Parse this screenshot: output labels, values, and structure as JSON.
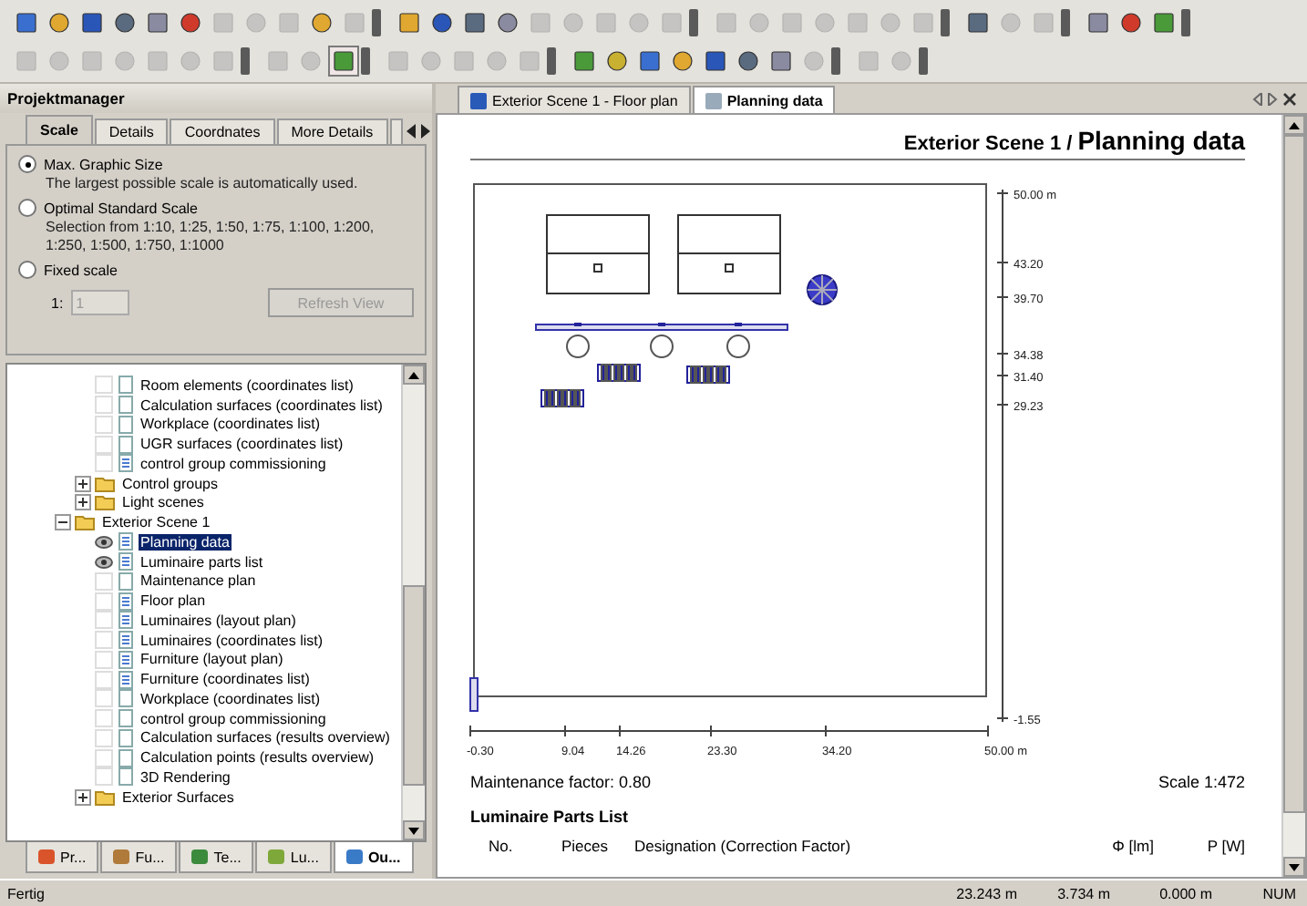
{
  "toolbar": {
    "rows": [
      [
        [
          {
            "disabled": false
          },
          {
            "disabled": false
          },
          {
            "disabled": false
          },
          {
            "disabled": false
          },
          {
            "disabled": false
          },
          {
            "disabled": false
          },
          {
            "disabled": true
          },
          {
            "disabled": true
          },
          {
            "disabled": true
          },
          {
            "disabled": false
          },
          {
            "disabled": true
          }
        ],
        [
          {
            "disabled": false
          },
          {
            "disabled": false
          },
          {
            "disabled": false
          },
          {
            "disabled": false
          },
          {
            "disabled": true
          },
          {
            "disabled": true
          },
          {
            "disabled": true
          },
          {
            "disabled": true
          },
          {
            "disabled": true
          }
        ],
        [
          {
            "disabled": true
          },
          {
            "disabled": true
          },
          {
            "disabled": true
          },
          {
            "disabled": true
          },
          {
            "disabled": true
          },
          {
            "disabled": true
          },
          {
            "disabled": true
          }
        ],
        [
          {
            "disabled": false
          },
          {
            "disabled": true
          },
          {
            "disabled": true
          }
        ],
        [
          {
            "disabled": false
          },
          {
            "disabled": false
          },
          {
            "disabled": false
          }
        ]
      ],
      [
        [
          {
            "disabled": true
          },
          {
            "disabled": true
          },
          {
            "disabled": true
          },
          {
            "disabled": true
          },
          {
            "disabled": true
          },
          {
            "disabled": true
          },
          {
            "disabled": true
          }
        ],
        [
          {
            "disabled": true
          },
          {
            "disabled": true
          },
          {
            "disabled": false
          }
        ],
        [
          {
            "disabled": true
          },
          {
            "disabled": true
          },
          {
            "disabled": true
          },
          {
            "disabled": true
          },
          {
            "disabled": true
          }
        ],
        [
          {
            "disabled": false
          },
          {
            "disabled": false
          },
          {
            "disabled": false
          },
          {
            "disabled": false
          },
          {
            "disabled": false
          },
          {
            "disabled": false
          },
          {
            "disabled": false
          },
          {
            "disabled": true
          }
        ],
        [
          {
            "disabled": true
          },
          {
            "disabled": true
          }
        ]
      ]
    ]
  },
  "project_manager": {
    "title": "Projektmanager",
    "tabs": [
      {
        "label": "Scale",
        "selected": true
      },
      {
        "label": "Details",
        "selected": false
      },
      {
        "label": "Coordnates",
        "selected": false
      },
      {
        "label": "More Details",
        "selected": false
      }
    ],
    "scale_options": [
      {
        "label": "Max. Graphic Size",
        "description": "The largest possible scale is automatically used.",
        "selected": true
      },
      {
        "label": "Optimal Standard Scale",
        "description": "Selection from 1:10, 1:25, 1:50, 1:75, 1:100, 1:200, 1:250, 1:500, 1:750, 1:1000",
        "selected": false
      },
      {
        "label": "Fixed scale",
        "selected": false
      }
    ],
    "fixed_scale": {
      "prefix": "1:",
      "value": "1",
      "disabled": true
    },
    "refresh_button": {
      "label": "Refresh View",
      "disabled": true
    },
    "tree": {
      "scrolled_branch": [
        {
          "label": "Room elements (coordinates list)",
          "kind": "empty-report",
          "marked": false,
          "selected": false
        },
        {
          "label": "Calculation surfaces (coordinates list)",
          "kind": "empty-report",
          "marked": false,
          "selected": false
        },
        {
          "label": "Workplace (coordinates list)",
          "kind": "empty-report",
          "marked": false,
          "selected": false
        },
        {
          "label": "UGR surfaces (coordinates list)",
          "kind": "empty-report",
          "marked": false,
          "selected": false
        },
        {
          "label": "control group commissioning",
          "kind": "report",
          "marked": false,
          "selected": false
        },
        {
          "label": "Control groups",
          "kind": "folder",
          "expanded": false,
          "selected": false
        },
        {
          "label": "Light scenes",
          "kind": "folder",
          "expanded": false,
          "selected": false
        }
      ],
      "items": [
        {
          "label": "Exterior Scene 1",
          "kind": "folder",
          "expanded": true,
          "selected": false,
          "children": [
            {
              "label": "Planning data",
              "kind": "report",
              "marked": true,
              "selected": true
            },
            {
              "label": "Luminaire parts list",
              "kind": "report",
              "marked": true,
              "selected": false
            },
            {
              "label": "Maintenance plan",
              "kind": "empty-report",
              "marked": false,
              "selected": false
            },
            {
              "label": "Floor plan",
              "kind": "report",
              "marked": false,
              "selected": false
            },
            {
              "label": "Luminaires (layout plan)",
              "kind": "report",
              "marked": false,
              "selected": false
            },
            {
              "label": "Luminaires (coordinates list)",
              "kind": "report",
              "marked": false,
              "selected": false
            },
            {
              "label": "Furniture (layout plan)",
              "kind": "report",
              "marked": false,
              "selected": false
            },
            {
              "label": "Furniture (coordinates list)",
              "kind": "report",
              "marked": false,
              "selected": false
            },
            {
              "label": "Workplace (coordinates list)",
              "kind": "empty-report",
              "marked": false,
              "selected": false
            },
            {
              "label": "control group commissioning",
              "kind": "empty-report",
              "marked": false,
              "selected": false
            },
            {
              "label": "Calculation surfaces (results overview)",
              "kind": "empty-report",
              "marked": false,
              "selected": false
            },
            {
              "label": "Calculation points (results overview)",
              "kind": "empty-report",
              "marked": false,
              "selected": false
            },
            {
              "label": "3D Rendering",
              "kind": "empty-report",
              "marked": false,
              "selected": false
            },
            {
              "label": "Exterior Surfaces",
              "kind": "folder",
              "expanded": false,
              "selected": false
            }
          ]
        }
      ]
    },
    "bottom_tabs": [
      {
        "label": "Pr...",
        "color": "#d9542b",
        "selected": false
      },
      {
        "label": "Fu...",
        "color": "#b07a3a",
        "selected": false
      },
      {
        "label": "Te...",
        "color": "#3c8a3c",
        "selected": false
      },
      {
        "label": "Lu...",
        "color": "#7fa83a",
        "selected": false
      },
      {
        "label": "Ou...",
        "color": "#3a7bc8",
        "selected": true
      }
    ]
  },
  "document": {
    "tabs": [
      {
        "label": "Exterior Scene 1 - Floor plan",
        "selected": false
      },
      {
        "label": "Planning data",
        "selected": true
      }
    ],
    "heading_prefix": "Exterior Scene 1 /",
    "heading": "Planning data",
    "plan": {
      "y_labels": [
        "50.00 m",
        "43.20",
        "39.70",
        "34.38",
        "31.40",
        "29.23",
        "-1.55"
      ],
      "x_labels": [
        "-0.30",
        "9.04",
        "14.26",
        "23.30",
        "34.20",
        "50.00 m"
      ]
    },
    "maintenance_factor": "Maintenance factor: 0.80",
    "scale": "Scale 1:472",
    "parts_list": {
      "title": "Luminaire Parts List",
      "columns": [
        "No.",
        "Pieces",
        "Designation (Correction Factor)",
        "Φ [lm]",
        "P [W]"
      ]
    }
  },
  "status_bar": {
    "message": "Fertig",
    "x": "23.243 m",
    "y": "3.734 m",
    "z": "0.000 m",
    "num": "NUM"
  }
}
